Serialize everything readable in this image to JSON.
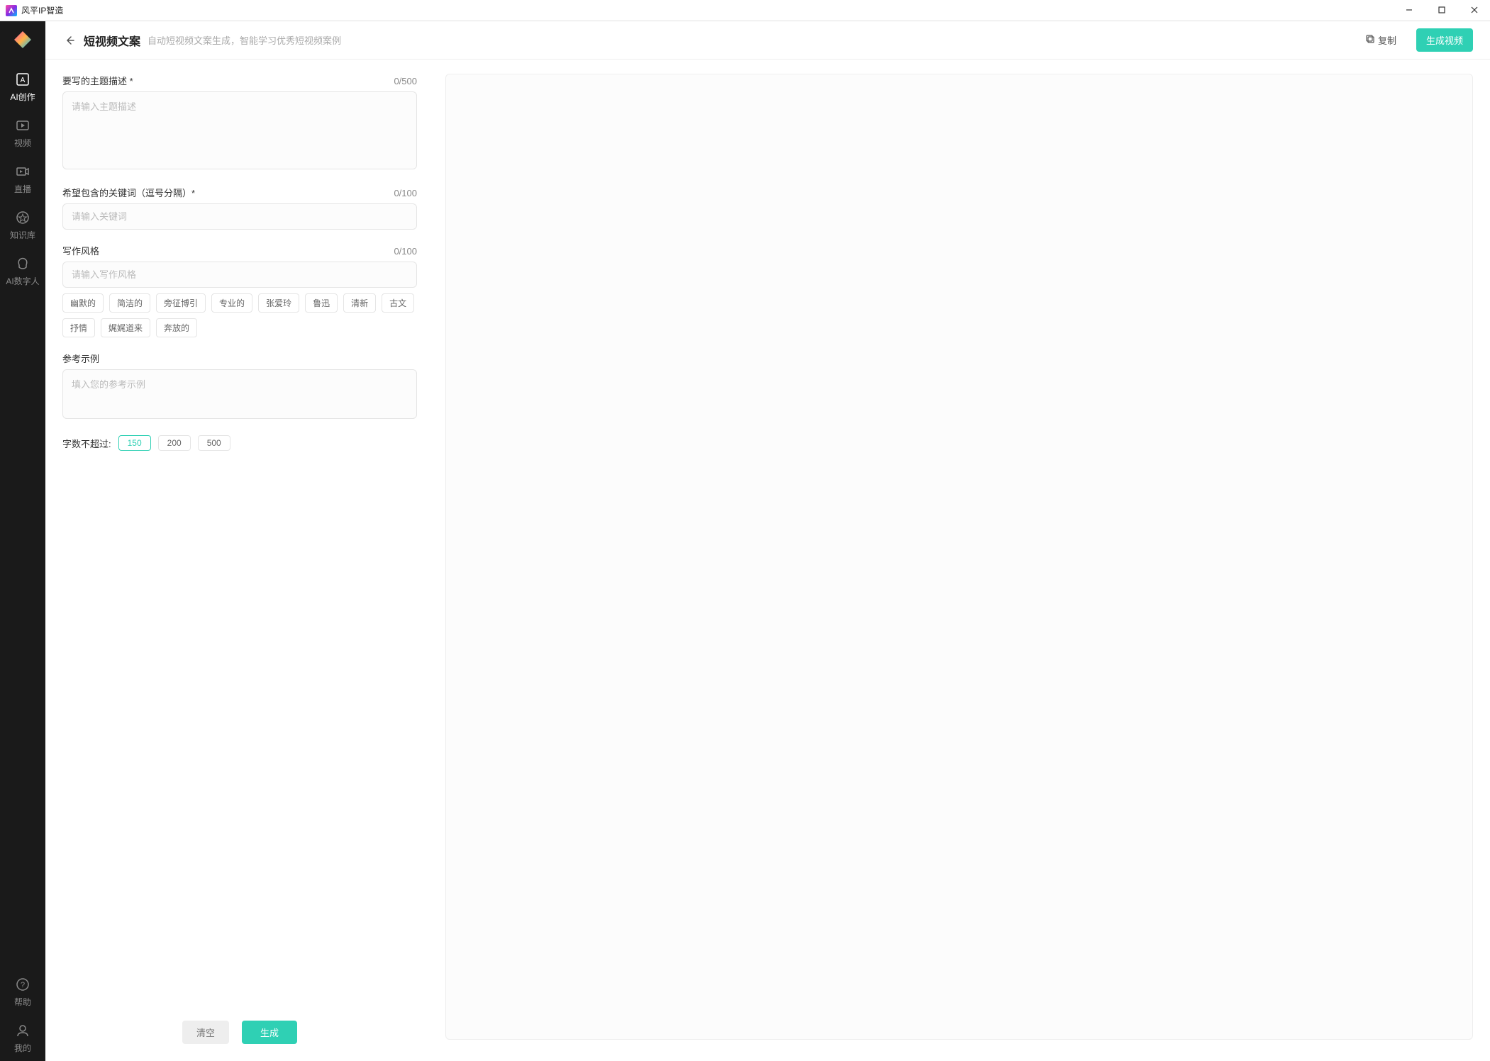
{
  "titlebar": {
    "app_name": "风平IP智造"
  },
  "sidebar": {
    "items": [
      {
        "label": "AI创作"
      },
      {
        "label": "视频"
      },
      {
        "label": "直播"
      },
      {
        "label": "知识库"
      },
      {
        "label": "AI数字人"
      }
    ],
    "bottom": [
      {
        "label": "帮助"
      },
      {
        "label": "我的"
      }
    ]
  },
  "header": {
    "title": "短视频文案",
    "subtitle": "自动短视频文案生成，智能学习优秀短视频案例",
    "copy_label": "复制",
    "gen_video_label": "生成视频"
  },
  "form": {
    "topic": {
      "label": "要写的主题描述 *",
      "count": "0/500",
      "placeholder": "请输入主题描述"
    },
    "keywords": {
      "label": "希望包含的关键词（逗号分隔）*",
      "count": "0/100",
      "placeholder": "请输入关键词"
    },
    "style": {
      "label": "写作风格",
      "count": "0/100",
      "placeholder": "请输入写作风格"
    },
    "style_tags": [
      "幽默的",
      "简洁的",
      "旁征博引",
      "专业的",
      "张爱玲",
      "鲁迅",
      "清新",
      "古文",
      "抒情",
      "娓娓道来",
      "奔放的"
    ],
    "example": {
      "label": "参考示例",
      "placeholder": "填入您的参考示例"
    },
    "wordlimit": {
      "label": "字数不超过:",
      "options": [
        "150",
        "200",
        "500"
      ],
      "active": "150"
    },
    "actions": {
      "clear": "清空",
      "generate": "生成"
    }
  }
}
